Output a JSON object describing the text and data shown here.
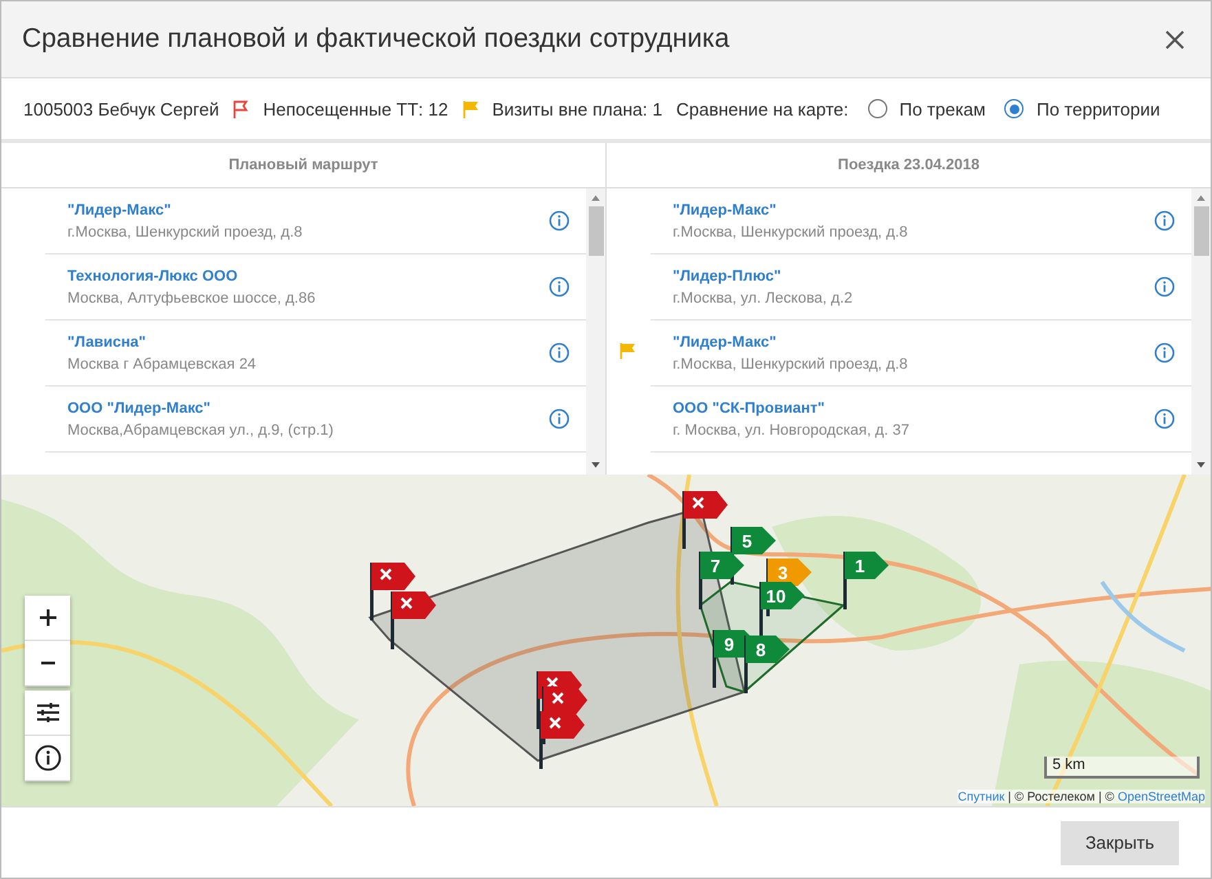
{
  "window": {
    "title": "Сравнение плановой и фактической поездки сотрудника"
  },
  "info_bar": {
    "employee": "1005003 Бебчук Сергей",
    "unvisited": "Непосещенные ТТ: 12",
    "unplanned": "Визиты вне плана: 1",
    "compare_label": "Сравнение на карте:",
    "compare_options": [
      {
        "label": "По трекам",
        "selected": false
      },
      {
        "label": "По территории",
        "selected": true
      }
    ]
  },
  "lists": [
    {
      "title": "Плановый маршрут",
      "rows": [
        {
          "name": "\"Лидер-Макс\"",
          "address": "г.Москва, Шенкурский проезд, д.8",
          "unplanned": false
        },
        {
          "name": "Технология-Люкс ООО",
          "address": "Москва, Алтуфьевское шоссе, д.86",
          "unplanned": false
        },
        {
          "name": "\"Лависна\"",
          "address": "Москва г Абрамцевская 24",
          "unplanned": false
        },
        {
          "name": "ООО \"Лидер-Макс\"",
          "address": "Москва,Абрамцевская ул., д.9, (стр.1)",
          "unplanned": false
        }
      ]
    },
    {
      "title": "Поездка 23.04.2018",
      "rows": [
        {
          "name": "\"Лидер-Макс\"",
          "address": "г.Москва, Шенкурский проезд, д.8",
          "unplanned": false
        },
        {
          "name": "\"Лидер-Плюс\"",
          "address": "г.Москва, ул. Лескова, д.2",
          "unplanned": false
        },
        {
          "name": "\"Лидер-Макс\"",
          "address": "г.Москва, Шенкурский проезд, д.8",
          "unplanned": true
        },
        {
          "name": "ООО \"СК-Провиант\"",
          "address": "г. Москва, ул. Новгородская, д. 37",
          "unplanned": false
        }
      ]
    }
  ],
  "map": {
    "markers": [
      {
        "kind": "missed"
      },
      {
        "kind": "missed"
      },
      {
        "kind": "missed"
      },
      {
        "kind": "missed"
      },
      {
        "kind": "missed"
      },
      {
        "kind": "missed"
      },
      {
        "kind": "visit",
        "label": "5"
      },
      {
        "kind": "visit",
        "label": "7"
      },
      {
        "kind": "unplanned",
        "label": "3"
      },
      {
        "kind": "visit",
        "label": "1"
      },
      {
        "kind": "visit",
        "label": "10"
      },
      {
        "kind": "visit",
        "label": "9"
      },
      {
        "kind": "visit",
        "label": "8"
      }
    ],
    "scale": "5 km",
    "attribution": [
      {
        "text": "Спутник",
        "link": true
      },
      {
        "text": " | © Ростелеком | © ",
        "link": false
      },
      {
        "text": "OpenStreetMap",
        "link": true
      }
    ]
  },
  "buttons": [
    {
      "label": "Закрыть"
    }
  ]
}
